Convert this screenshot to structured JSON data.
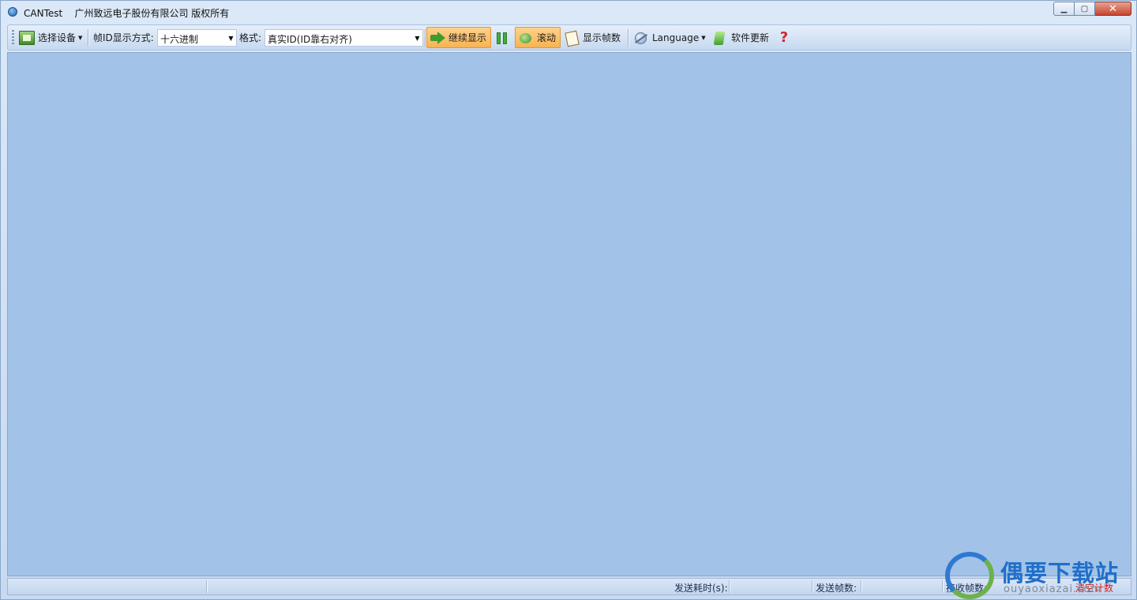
{
  "window": {
    "title": "CANTest    广州致远电子股份有限公司 版权所有",
    "minimize_glyph": "▁",
    "maximize_glyph": "▢",
    "close_glyph": "✕"
  },
  "toolbar": {
    "select_device": "选择设备",
    "id_display_label": "帧ID显示方式:",
    "id_display_value": "十六进制",
    "format_label": "格式:",
    "format_value": "真实ID(ID靠右对齐)",
    "continue_display": "继续显示",
    "scroll": "滚动",
    "show_frame_count": "显示帧数",
    "language": "Language",
    "software_update": "软件更新",
    "help_glyph": "?"
  },
  "statusbar": {
    "send_time_label": "发送耗时(s):",
    "send_frames_label": "发送帧数:",
    "receive_frames_label": "接收帧数:",
    "clear_count": "清空计数"
  },
  "watermark": {
    "title": "偶要下载站",
    "url": "ouyaoxiazai.com"
  },
  "colors": {
    "main_area": "#a3c2e8",
    "highlight": "#f8b350",
    "accent": "#1f6fc9"
  }
}
